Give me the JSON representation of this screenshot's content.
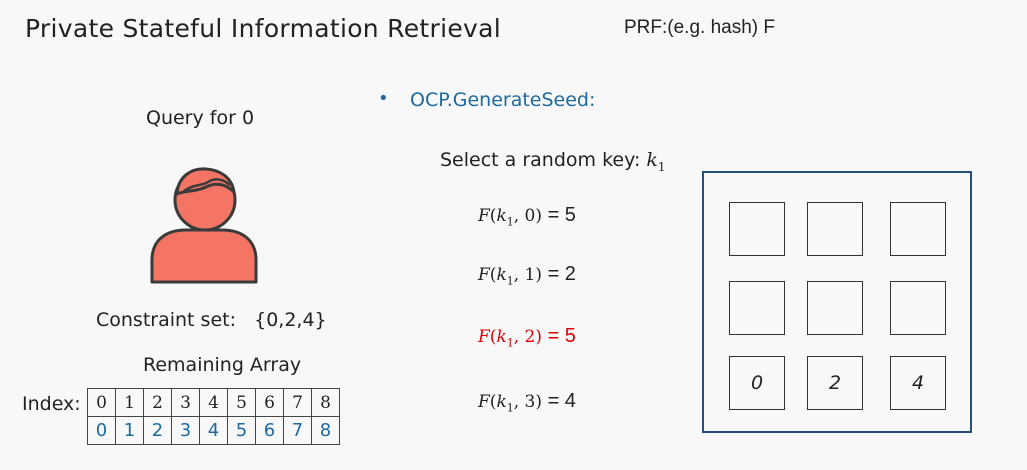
{
  "title": "Private Stateful Information Retrieval",
  "prf_label": "PRF:(e.g. hash) F",
  "query_label": "Query for 0",
  "bullet": "•",
  "ocp_label": "OCP.GenerateSeed:",
  "select_key": {
    "text": "Select a random key: ",
    "var": "k",
    "sub": "1"
  },
  "prf_evals": [
    {
      "func": "F",
      "key": "k",
      "key_sub": "1",
      "arg": "0",
      "result": "5",
      "highlight": false
    },
    {
      "func": "F",
      "key": "k",
      "key_sub": "1",
      "arg": "1",
      "result": "2",
      "highlight": false
    },
    {
      "func": "F",
      "key": "k",
      "key_sub": "1",
      "arg": "2",
      "result": "5",
      "highlight": true
    },
    {
      "func": "F",
      "key": "k",
      "key_sub": "1",
      "arg": "3",
      "result": "4",
      "highlight": false
    }
  ],
  "constraint": {
    "label": "Constraint set:",
    "value": "{0,2,4}"
  },
  "remaining_label": "Remaining Array",
  "index_label": "Index:",
  "array_indices": [
    "0",
    "1",
    "2",
    "3",
    "4",
    "5",
    "6",
    "7",
    "8"
  ],
  "array_values": [
    "0",
    "1",
    "2",
    "3",
    "4",
    "5",
    "6",
    "7",
    "8"
  ],
  "grid_cells": [
    "",
    "",
    "",
    "",
    "",
    "",
    "0",
    "2",
    "4"
  ],
  "colors": {
    "user_icon": "#f57565",
    "accent_blue": "#1d6aa0",
    "highlight_red": "#e00000",
    "panel_border": "#264e7a"
  },
  "icons": {
    "user": "user-icon"
  }
}
